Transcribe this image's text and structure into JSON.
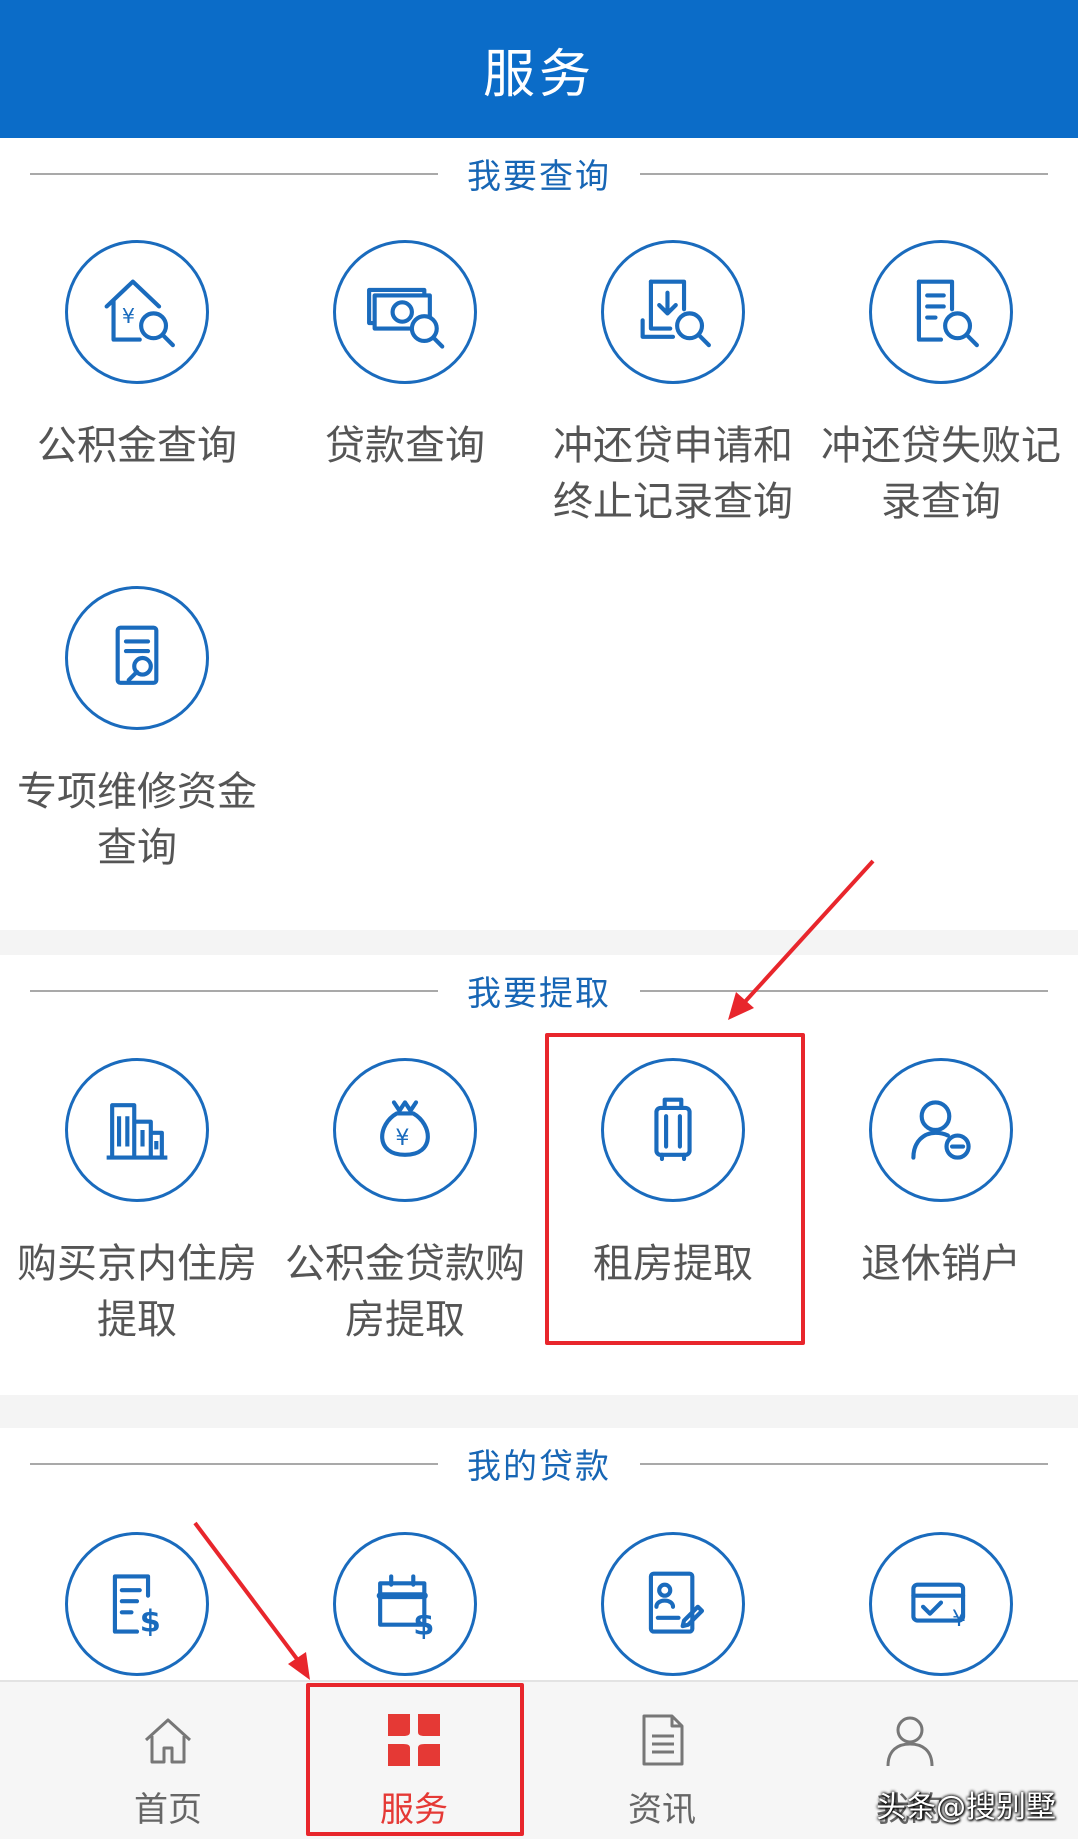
{
  "header": {
    "title": "服务"
  },
  "sections": {
    "query": {
      "title": "我要查询",
      "items": [
        {
          "label": "公积金查询",
          "icon": "house-yuan-search-icon"
        },
        {
          "label": "贷款查询",
          "icon": "cash-search-icon"
        },
        {
          "label": "冲还贷申请和\n终止记录查询",
          "icon": "download-doc-search-icon"
        },
        {
          "label": "冲还贷失败记\n录查询",
          "icon": "document-search-icon"
        },
        {
          "label": "专项维修资金\n查询",
          "icon": "document-wrench-icon"
        }
      ]
    },
    "withdraw": {
      "title": "我要提取",
      "items": [
        {
          "label": "购买京内住房\n提取",
          "icon": "buildings-icon"
        },
        {
          "label": "公积金贷款购\n房提取",
          "icon": "money-bag-icon"
        },
        {
          "label": "租房提取",
          "icon": "luggage-icon"
        },
        {
          "label": "退休销户",
          "icon": "user-minus-icon"
        }
      ]
    },
    "loan": {
      "title": "我的贷款",
      "items": [
        {
          "icon": "checklist-dollar-icon"
        },
        {
          "icon": "calendar-dollar-icon"
        },
        {
          "icon": "id-card-edit-icon"
        },
        {
          "icon": "card-check-yuan-icon"
        }
      ]
    }
  },
  "tabbar": {
    "tabs": [
      {
        "label": "首页",
        "icon": "home-icon"
      },
      {
        "label": "服务",
        "icon": "grid-icon"
      },
      {
        "label": "资讯",
        "icon": "news-icon"
      },
      {
        "label": "我的",
        "icon": "user-icon"
      }
    ],
    "active": "服务"
  },
  "watermark": "头条@搜别墅",
  "colors": {
    "brand": "#0b6cc8",
    "icon": "#1a6bbd",
    "highlight": "#e8262c",
    "active_tab": "#e53935"
  }
}
